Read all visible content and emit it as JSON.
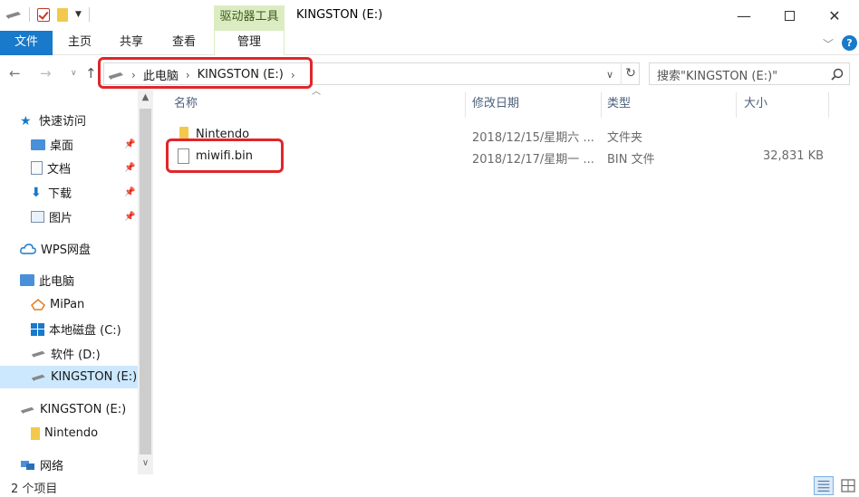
{
  "window": {
    "title": "KINGSTON (E:)",
    "context_tab": "驱动器工具"
  },
  "ribbon": {
    "tabs": [
      "文件",
      "主页",
      "共享",
      "查看",
      "管理"
    ]
  },
  "address": {
    "parts": [
      "此电脑",
      "KINGSTON (E:)"
    ]
  },
  "search": {
    "placeholder": "搜索\"KINGSTON (E:)\""
  },
  "sidebar": {
    "items": [
      {
        "label": "快速访问",
        "icon": "star-icon"
      },
      {
        "label": "桌面",
        "icon": "desktop-folder-icon",
        "pinned": true
      },
      {
        "label": "文档",
        "icon": "document-icon",
        "pinned": true
      },
      {
        "label": "下载",
        "icon": "download-icon",
        "pinned": true
      },
      {
        "label": "图片",
        "icon": "picture-icon",
        "pinned": true
      },
      {
        "label": "WPS网盘",
        "icon": "cloud-icon"
      },
      {
        "label": "此电脑",
        "icon": "pc-icon"
      },
      {
        "label": "MiPan",
        "icon": "mipan-icon"
      },
      {
        "label": "本地磁盘 (C:)",
        "icon": "windows-drive-icon"
      },
      {
        "label": "软件 (D:)",
        "icon": "drive-icon"
      },
      {
        "label": "KINGSTON (E:)",
        "icon": "usb-drive-icon",
        "selected": true
      },
      {
        "label": "KINGSTON (E:)",
        "icon": "usb-drive-icon"
      },
      {
        "label": "Nintendo",
        "icon": "folder-icon"
      },
      {
        "label": "网络",
        "icon": "network-icon"
      }
    ]
  },
  "columns": {
    "name": "名称",
    "date": "修改日期",
    "type": "类型",
    "size": "大小"
  },
  "files": [
    {
      "name": "Nintendo",
      "date": "2018/12/15/星期六 ...",
      "type": "文件夹",
      "size": "",
      "icon": "folder-icon"
    },
    {
      "name": "miwifi.bin",
      "date": "2018/12/17/星期一 ...",
      "type": "BIN 文件",
      "size": "32,831 KB",
      "icon": "file-icon"
    }
  ],
  "status": {
    "count": "2 个项目"
  },
  "colors": {
    "accent": "#1979ca",
    "selection": "#cce8ff",
    "highlight": "#e0262b",
    "context_tab": "#dcecc2"
  }
}
